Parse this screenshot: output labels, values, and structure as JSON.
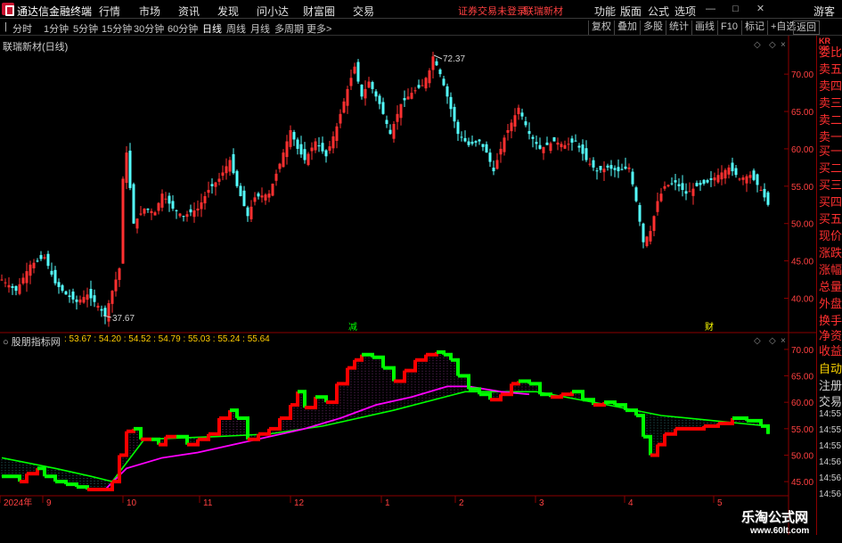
{
  "app": {
    "title": "通达信金融终端",
    "menus": [
      "行情",
      "市场",
      "资讯",
      "发现",
      "问小达",
      "财富圈",
      "交易"
    ],
    "notice": "证券交易未登录",
    "stock_short": "联瑞新材",
    "right_menus": [
      "功能",
      "版面",
      "公式",
      "选项"
    ],
    "guest": "游客"
  },
  "toolbar": {
    "periods": [
      "分时",
      "1分钟",
      "5分钟",
      "15分钟",
      "30分钟",
      "60分钟",
      "日线",
      "周线",
      "月线",
      "多周期",
      "更多>"
    ],
    "active": "日线",
    "right_buttons": [
      "复权",
      "叠加",
      "多股",
      "统计",
      "画线",
      "F10",
      "标记",
      "+自选",
      "返回"
    ]
  },
  "chart": {
    "stock_title": "联瑞新材(日线)",
    "indicator_title": "股朋指标网",
    "indicator_values": ": 53.67 : 54.20 : 54.52 : 54.79 : 55.03 : 55.24 : 55.64",
    "high_label": "72.37",
    "low_label": "37.67",
    "marker_jian": "减",
    "marker_cai": "财",
    "colors": {
      "up": "#ff3030",
      "down": "#54ffff",
      "ind_red": "#ff0000",
      "ind_green": "#00ff00",
      "ind_line": "#ff00ff",
      "grid": "#8b0000",
      "axis_text": "#ff4040"
    }
  },
  "chart_data": {
    "type": "candlestick",
    "price_axis": {
      "ticks": [
        "70.00",
        "65.00",
        "60.00",
        "55.00",
        "50.00",
        "45.00",
        "40.00"
      ],
      "values": [
        70,
        65,
        60,
        55,
        50,
        45,
        40
      ],
      "ylim": [
        36,
        73
      ]
    },
    "indicator_axis": {
      "ticks": [
        "70.00",
        "65.00",
        "60.00",
        "55.00",
        "50.00",
        "45.00"
      ],
      "values": [
        70,
        65,
        60,
        55,
        50,
        45
      ],
      "ylim": [
        43,
        72
      ]
    },
    "x_labels": [
      "2024年",
      "9",
      "10",
      "11",
      "12",
      "1",
      "2",
      "3",
      "4",
      "5"
    ],
    "close_path": [
      [
        0,
        42.5
      ],
      [
        8,
        41.0
      ],
      [
        16,
        44.5
      ],
      [
        24,
        45.5
      ],
      [
        30,
        42.0
      ],
      [
        36,
        40.5
      ],
      [
        42,
        39.5
      ],
      [
        48,
        40.5
      ],
      [
        54,
        39.0
      ],
      [
        58,
        37.67
      ],
      [
        62,
        41.0
      ],
      [
        66,
        44.0
      ],
      [
        68,
        56.0
      ],
      [
        70,
        59.5
      ],
      [
        74,
        50.0
      ],
      [
        80,
        52.0
      ],
      [
        86,
        51.5
      ],
      [
        90,
        54.0
      ],
      [
        96,
        52.0
      ],
      [
        102,
        51.0
      ],
      [
        110,
        52.0
      ],
      [
        116,
        54.5
      ],
      [
        122,
        56.0
      ],
      [
        128,
        58.5
      ],
      [
        132,
        55.0
      ],
      [
        138,
        51.0
      ],
      [
        142,
        53.5
      ],
      [
        150,
        54.0
      ],
      [
        156,
        58.0
      ],
      [
        162,
        62.5
      ],
      [
        166,
        60.0
      ],
      [
        170,
        58.5
      ],
      [
        176,
        61.0
      ],
      [
        182,
        59.0
      ],
      [
        188,
        63.0
      ],
      [
        194,
        68.0
      ],
      [
        198,
        71.0
      ],
      [
        202,
        67.0
      ],
      [
        206,
        69.0
      ],
      [
        212,
        66.0
      ],
      [
        218,
        62.0
      ],
      [
        224,
        66.0
      ],
      [
        230,
        67.5
      ],
      [
        236,
        68.5
      ],
      [
        240,
        70.5
      ],
      [
        242,
        72.37
      ],
      [
        246,
        70.0
      ],
      [
        250,
        67.0
      ],
      [
        256,
        62.0
      ],
      [
        262,
        60.5
      ],
      [
        268,
        61.0
      ],
      [
        272,
        59.5
      ],
      [
        276,
        57.0
      ],
      [
        282,
        61.5
      ],
      [
        290,
        65.5
      ],
      [
        296,
        62.0
      ],
      [
        302,
        60.0
      ],
      [
        310,
        61.0
      ],
      [
        316,
        60.5
      ],
      [
        322,
        61.0
      ],
      [
        328,
        58.5
      ],
      [
        334,
        57.0
      ],
      [
        340,
        57.5
      ],
      [
        346,
        57.0
      ],
      [
        352,
        57.5
      ],
      [
        356,
        53.0
      ],
      [
        360,
        47.5
      ],
      [
        364,
        49.0
      ],
      [
        368,
        53.0
      ],
      [
        372,
        55.0
      ],
      [
        378,
        55.5
      ],
      [
        384,
        54.0
      ],
      [
        390,
        55.0
      ],
      [
        396,
        55.5
      ],
      [
        402,
        56.5
      ],
      [
        408,
        57.5
      ],
      [
        414,
        56.0
      ],
      [
        420,
        56.5
      ],
      [
        426,
        54.5
      ],
      [
        430,
        52.5
      ]
    ],
    "indicator": {
      "step": [
        [
          0,
          46.0
        ],
        [
          10,
          45.0
        ],
        [
          14,
          46.5
        ],
        [
          20,
          47.5
        ],
        [
          24,
          46.0
        ],
        [
          30,
          45.0
        ],
        [
          36,
          44.5
        ],
        [
          42,
          44.0
        ],
        [
          48,
          43.5
        ],
        [
          56,
          43.5
        ],
        [
          62,
          45.0
        ],
        [
          66,
          50.0
        ],
        [
          70,
          54.5
        ],
        [
          74,
          55.0
        ],
        [
          78,
          53.0
        ],
        [
          84,
          53.0
        ],
        [
          88,
          52.0
        ],
        [
          92,
          53.5
        ],
        [
          98,
          53.5
        ],
        [
          104,
          52.0
        ],
        [
          110,
          53.0
        ],
        [
          116,
          54.0
        ],
        [
          122,
          57.0
        ],
        [
          128,
          58.5
        ],
        [
          132,
          57.0
        ],
        [
          138,
          53.0
        ],
        [
          144,
          54.0
        ],
        [
          150,
          55.0
        ],
        [
          156,
          57.0
        ],
        [
          162,
          59.5
        ],
        [
          166,
          62.0
        ],
        [
          170,
          59.0
        ],
        [
          176,
          61.0
        ],
        [
          182,
          60.0
        ],
        [
          188,
          63.5
        ],
        [
          194,
          66.5
        ],
        [
          198,
          68.0
        ],
        [
          202,
          69.0
        ],
        [
          208,
          68.5
        ],
        [
          214,
          66.5
        ],
        [
          220,
          64.0
        ],
        [
          226,
          66.0
        ],
        [
          232,
          68.0
        ],
        [
          238,
          69.0
        ],
        [
          244,
          69.5
        ],
        [
          248,
          69.0
        ],
        [
          252,
          68.0
        ],
        [
          256,
          65.0
        ],
        [
          262,
          62.5
        ],
        [
          268,
          61.5
        ],
        [
          274,
          60.5
        ],
        [
          280,
          61.5
        ],
        [
          286,
          63.5
        ],
        [
          290,
          64.0
        ],
        [
          296,
          63.5
        ],
        [
          302,
          61.5
        ],
        [
          308,
          61.0
        ],
        [
          314,
          61.5
        ],
        [
          320,
          62.0
        ],
        [
          326,
          60.5
        ],
        [
          332,
          59.5
        ],
        [
          338,
          60.0
        ],
        [
          344,
          59.5
        ],
        [
          350,
          58.5
        ],
        [
          356,
          57.5
        ],
        [
          360,
          53.5
        ],
        [
          364,
          50.0
        ],
        [
          368,
          52.0
        ],
        [
          372,
          54.0
        ],
        [
          378,
          55.0
        ],
        [
          386,
          55.0
        ],
        [
          394,
          55.5
        ],
        [
          402,
          56.0
        ],
        [
          410,
          57.0
        ],
        [
          418,
          56.5
        ],
        [
          426,
          55.5
        ],
        [
          430,
          54.0
        ]
      ],
      "ma_line": [
        [
          58,
          43.5
        ],
        [
          70,
          47.5
        ],
        [
          90,
          49.5
        ],
        [
          110,
          50.5
        ],
        [
          130,
          52.0
        ],
        [
          150,
          53.5
        ],
        [
          170,
          55.0
        ],
        [
          190,
          57.0
        ],
        [
          210,
          59.5
        ],
        [
          230,
          61.0
        ],
        [
          250,
          63.0
        ],
        [
          262,
          63.0
        ],
        [
          280,
          62.0
        ],
        [
          296,
          61.5
        ]
      ],
      "green_line": [
        [
          0,
          49.5
        ],
        [
          30,
          47.5
        ],
        [
          50,
          46.0
        ],
        [
          62,
          45.0
        ],
        [
          80,
          53.0
        ],
        [
          120,
          53.5
        ],
        [
          150,
          54.0
        ],
        [
          180,
          55.5
        ],
        [
          220,
          58.5
        ],
        [
          260,
          62.0
        ],
        [
          300,
          62.0
        ],
        [
          340,
          59.5
        ],
        [
          370,
          57.5
        ],
        [
          400,
          56.5
        ],
        [
          430,
          55.5
        ]
      ]
    }
  }
}
